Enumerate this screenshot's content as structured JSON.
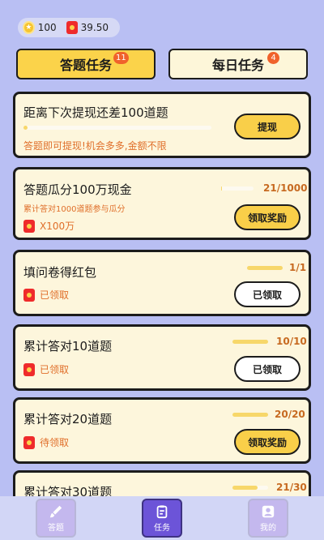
{
  "balance": {
    "coins": "100",
    "cash": "39.50",
    "coin_glyph": "★"
  },
  "tabs": [
    {
      "label": "答题任务",
      "badge": "11"
    },
    {
      "label": "每日任务",
      "badge": "4"
    }
  ],
  "cards": [
    {
      "title": "距离下次提现还差100道题",
      "subtitle": "答题即可提现!机会多多,金额不限",
      "button": "提现",
      "progress": 0.02
    },
    {
      "title": "答题瓜分100万现金",
      "subtitle": "累计答对1000道题参与瓜分",
      "reward": "X100万",
      "progress_text": "21/1000",
      "progress": 0.02,
      "button": "领取奖励"
    },
    {
      "title": "填问卷得红包",
      "reward": "已领取",
      "progress_text": "1/1",
      "progress": 1.0,
      "button": "已领取"
    },
    {
      "title": "累计答对10道题",
      "reward": "已领取",
      "progress_text": "10/10",
      "progress": 1.0,
      "button": "已领取"
    },
    {
      "title": "累计答对20道题",
      "reward": "待领取",
      "progress_text": "20/20",
      "progress": 1.0,
      "button": "领取奖励"
    },
    {
      "title": "累计答对30道题",
      "progress_text": "21/30",
      "progress": 0.7
    }
  ],
  "nav": [
    {
      "label": "答题",
      "icon": "brush-icon"
    },
    {
      "label": "任务",
      "icon": "clipboard-icon"
    },
    {
      "label": "我的",
      "icon": "user-icon"
    }
  ],
  "colors": {
    "background": "#b9bff3",
    "card": "#fdf6dc",
    "accent_yellow": "#f9cf49",
    "orange": "#e06f2a",
    "nav_active": "#6c54d8"
  }
}
